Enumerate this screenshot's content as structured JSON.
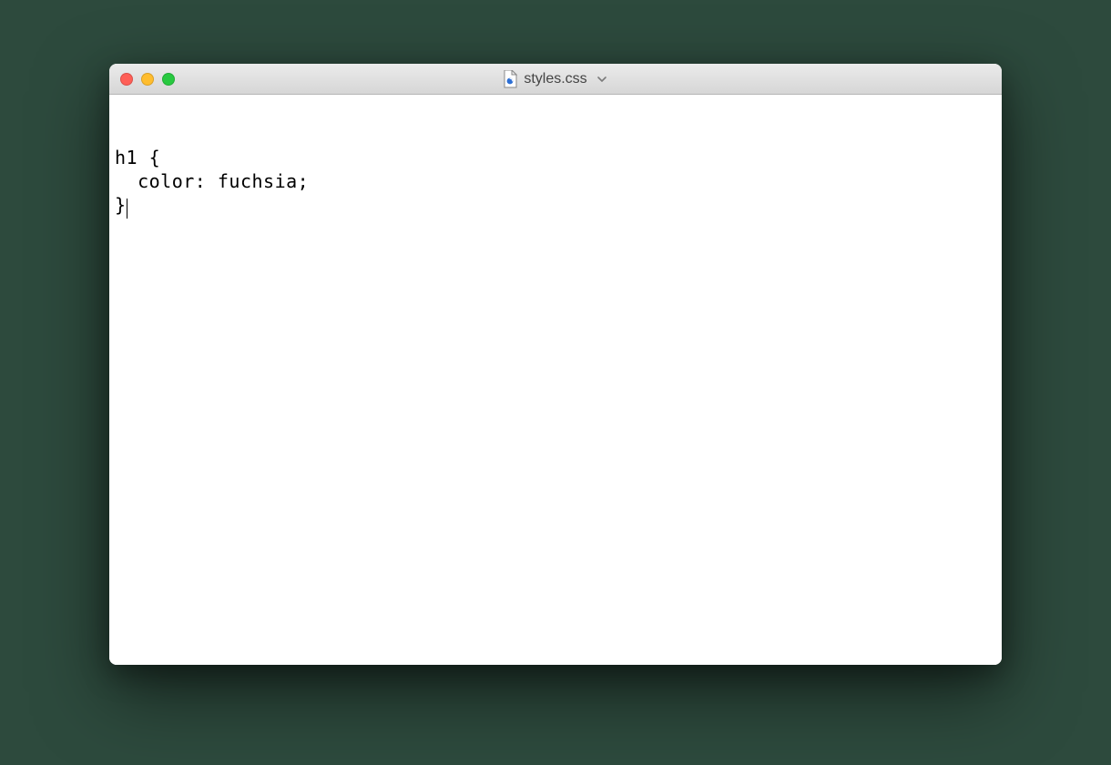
{
  "window": {
    "title": "styles.css",
    "traffic_lights": {
      "close": "red",
      "minimize": "yellow",
      "zoom": "green"
    }
  },
  "editor": {
    "content": {
      "line1": "h1 {",
      "line2": "  color: fuchsia;",
      "line3": "}"
    }
  }
}
